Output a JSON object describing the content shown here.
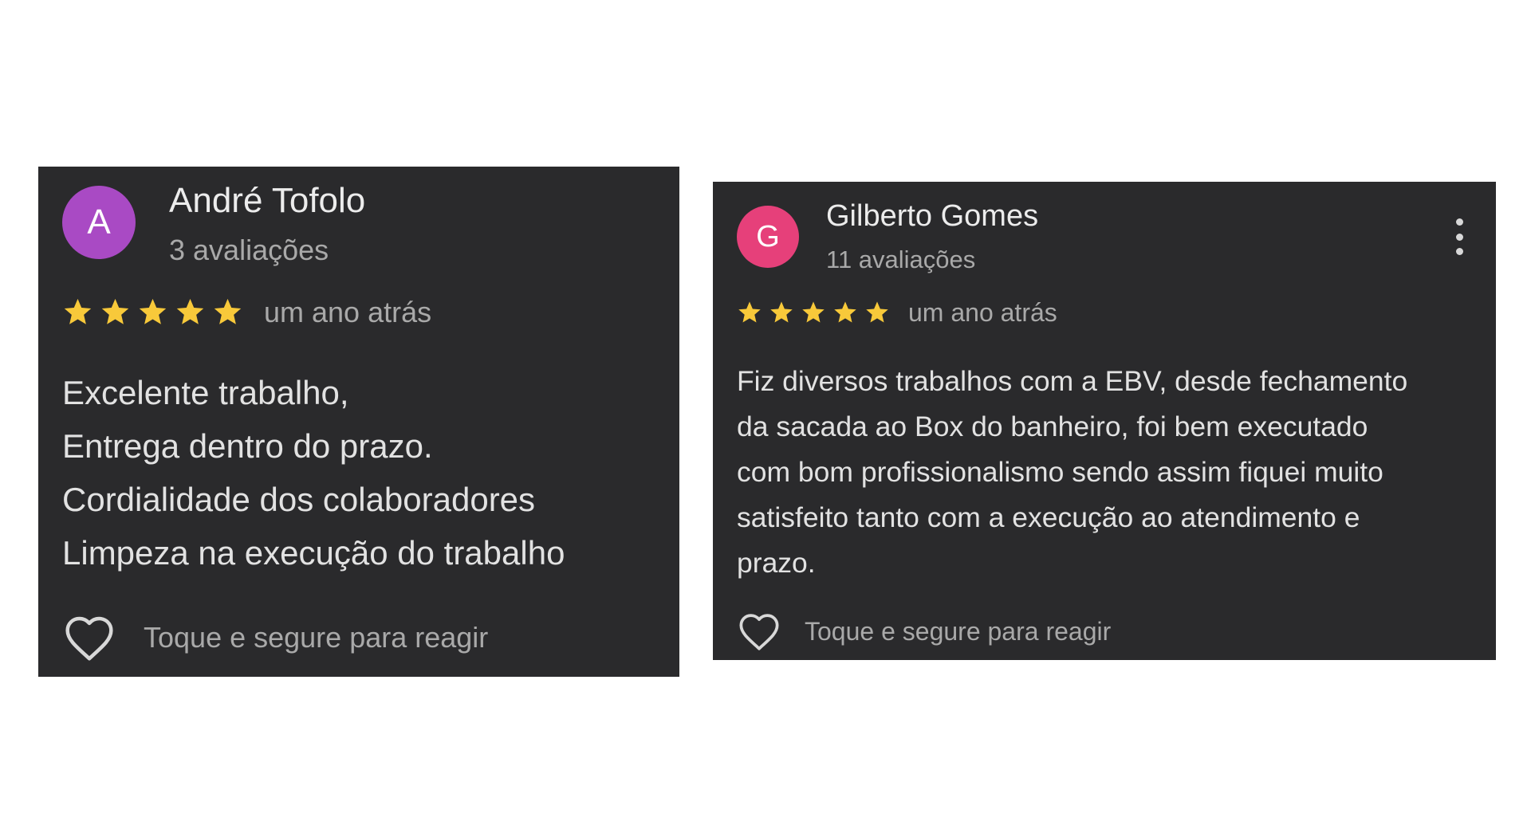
{
  "reviews": [
    {
      "avatar_letter": "A",
      "avatar_color": "#a94ac4",
      "author": "André Tofolo",
      "review_count": "3 avaliações",
      "rating": 5,
      "max_rating": 5,
      "date": "um ano atrás",
      "text_lines": [
        "Excelente trabalho,",
        "Entrega dentro do prazo.",
        "Cordialidade dos colaboradores",
        "Limpeza na execução do trabalho"
      ],
      "react_icon": "heart-outline-icon",
      "react_label": "Toque e segure para reagir"
    },
    {
      "avatar_letter": "G",
      "avatar_color": "#e6407a",
      "author": "Gilberto Gomes",
      "review_count": "11 avaliações",
      "rating": 5,
      "max_rating": 5,
      "date": "um ano atrás",
      "text_lines": [
        "Fiz diversos trabalhos com a EBV, desde fechamento",
        "da sacada ao Box do banheiro, foi bem executado",
        "com bom profissionalismo sendo assim fiquei muito",
        "satisfeito tanto com a execução ao atendimento e",
        "prazo."
      ],
      "react_icon": "heart-outline-icon",
      "react_label": "Toque e segure para reagir",
      "menu_icon": "more-vertical-icon"
    }
  ],
  "colors": {
    "card_background": "#2a2a2c",
    "star": "#f8c93a",
    "page_background": "#ffffff"
  }
}
